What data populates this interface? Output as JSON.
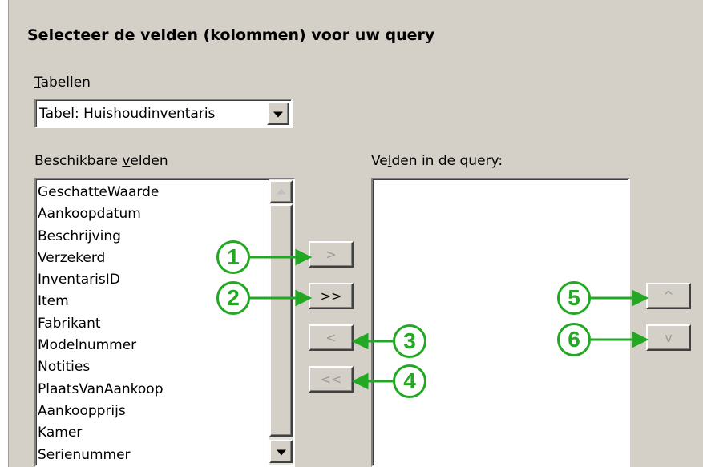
{
  "title": "Selecteer de velden (kolommen) voor uw query",
  "tables": {
    "label_mnemonic": "T",
    "label_rest": "abellen",
    "selected": "Tabel: Huishoudinventaris"
  },
  "available": {
    "label_pre": "Beschikbare ",
    "label_mnemonic": "v",
    "label_post": "elden",
    "items": [
      "GeschatteWaarde",
      "Aankoopdatum",
      "Beschrijving",
      "Verzekerd",
      "InventarisID",
      "Item",
      "Fabrikant",
      "Modelnummer",
      "Notities",
      "PlaatsVanAankoop",
      "Aankoopprijs",
      "Kamer",
      "Serienummer"
    ]
  },
  "query_fields": {
    "label_pre": "Ve",
    "label_mnemonic": "l",
    "label_post": "den in de query:",
    "items": []
  },
  "buttons": {
    "add_one": ">",
    "add_all": ">>",
    "remove_one": "<",
    "remove_all": "<<",
    "move_up": "^",
    "move_down": "v"
  },
  "callouts": [
    "1",
    "2",
    "3",
    "4",
    "5",
    "6"
  ],
  "colors": {
    "callout_green": "#22a822",
    "dialog_bg": "#d4d0c8"
  },
  "icons": {
    "combo_arrow": "triangle-down-icon",
    "scroll_up": "triangle-up-icon",
    "scroll_down": "triangle-down-icon"
  }
}
